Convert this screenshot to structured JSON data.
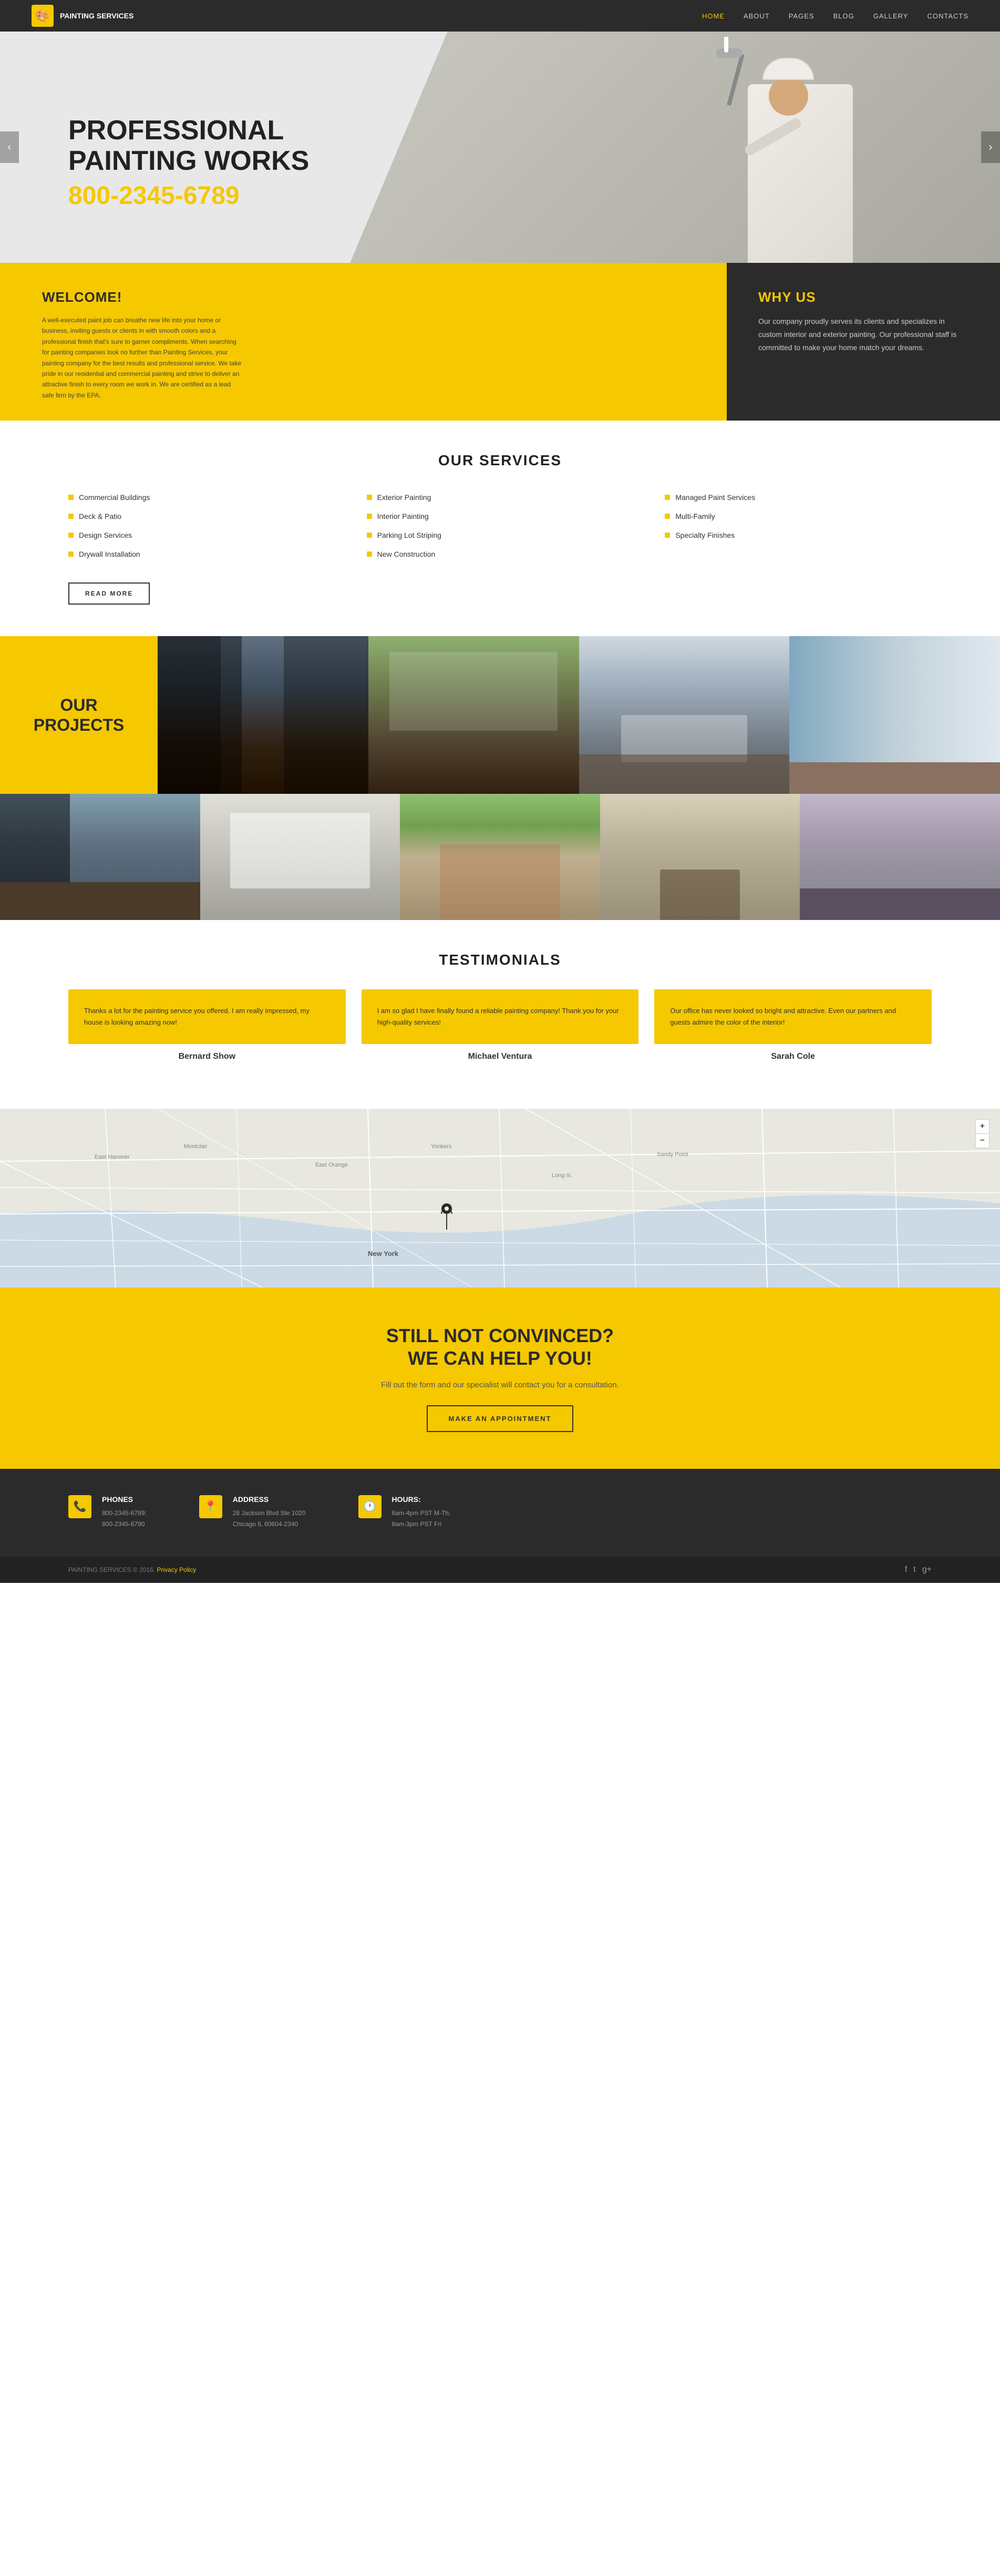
{
  "brand": {
    "name": "PAINTING SERVICES",
    "logo_icon": "🎨"
  },
  "nav": {
    "items": [
      {
        "label": "HOME",
        "active": true
      },
      {
        "label": "ABOUT",
        "active": false
      },
      {
        "label": "PAGES",
        "active": false
      },
      {
        "label": "BLOG",
        "active": false
      },
      {
        "label": "GALLERY",
        "active": false
      },
      {
        "label": "CONTACTS",
        "active": false
      }
    ]
  },
  "hero": {
    "title_line1": "PROFESSIONAL",
    "title_line2": "PAINTING WORKS",
    "phone": "800-2345-6789",
    "prev_arrow": "‹",
    "next_arrow": "›"
  },
  "welcome": {
    "title": "WELCOME!",
    "body": "A well-executed paint job can breathe new life into your home or business, inviting guests or clients in with smooth colors and a professional finish that's sure to garner compliments. When searching for painting companies look no further than Painting Services, your painting company for the best results and professional service. We take pride in our residential and commercial painting and strive to deliver an attractive finish to every room we work in. We are certified as a lead safe firm by the EPA."
  },
  "why_us": {
    "title": "WHY US",
    "body": "Our company proudly serves its clients and specializes in custom interior and exterior painting. Our professional staff is committed to make your home match your dreams."
  },
  "services": {
    "title": "OUR SERVICES",
    "items": [
      {
        "label": "Commercial Buildings"
      },
      {
        "label": "Exterior Painting"
      },
      {
        "label": "Managed Paint Services"
      },
      {
        "label": "Deck & Patio"
      },
      {
        "label": "Interior Painting"
      },
      {
        "label": "Multi-Family"
      },
      {
        "label": "Design Services"
      },
      {
        "label": "Parking Lot Striping"
      },
      {
        "label": "Specialty Finishes"
      },
      {
        "label": "Drywall Installation"
      },
      {
        "label": "New Construction"
      }
    ],
    "read_more": "READ MORE"
  },
  "projects": {
    "title_line1": "OUR",
    "title_line2": "PROJECTS"
  },
  "testimonials": {
    "title": "TESTIMONIALS",
    "items": [
      {
        "text": "Thanks a lot for the painting service you offered. I am really impressed, my house is looking amazing now!",
        "name": "Bernard Show"
      },
      {
        "text": "I am so glad I have finally found a reliable painting company! Thank you for your high-quality services!",
        "name": "Michael Ventura"
      },
      {
        "text": "Our office has never looked so bright and attractive. Even our partners and guests admire the color of the interior!",
        "name": "Sarah Cole"
      }
    ]
  },
  "cta": {
    "title_line1": "STILL NOT CONVINCED?",
    "title_line2": "WE CAN HELP YOU!",
    "subtitle": "Fill out the form and our specialist will contact you for a consultation.",
    "button": "MAKE AN APPOINTMENT"
  },
  "footer": {
    "cols": [
      {
        "icon": "📞",
        "title": "Phones",
        "lines": [
          "800-2345-6789;",
          "800-2345-6790"
        ]
      },
      {
        "icon": "📍",
        "title": "Address",
        "lines": [
          "28 Jackson Blvd Ste 1020",
          "Chicago IL 60604-2340"
        ]
      },
      {
        "icon": "🕐",
        "title": "Hours:",
        "lines": [
          "6am-4pm PST M-Th;",
          "8am-3pm PST Fri"
        ]
      }
    ]
  },
  "footer_bottom": {
    "copyright": "PAINTING SERVICES © 2016.",
    "privacy": "Privacy Policy",
    "social": [
      "f",
      "t",
      "g+"
    ]
  }
}
